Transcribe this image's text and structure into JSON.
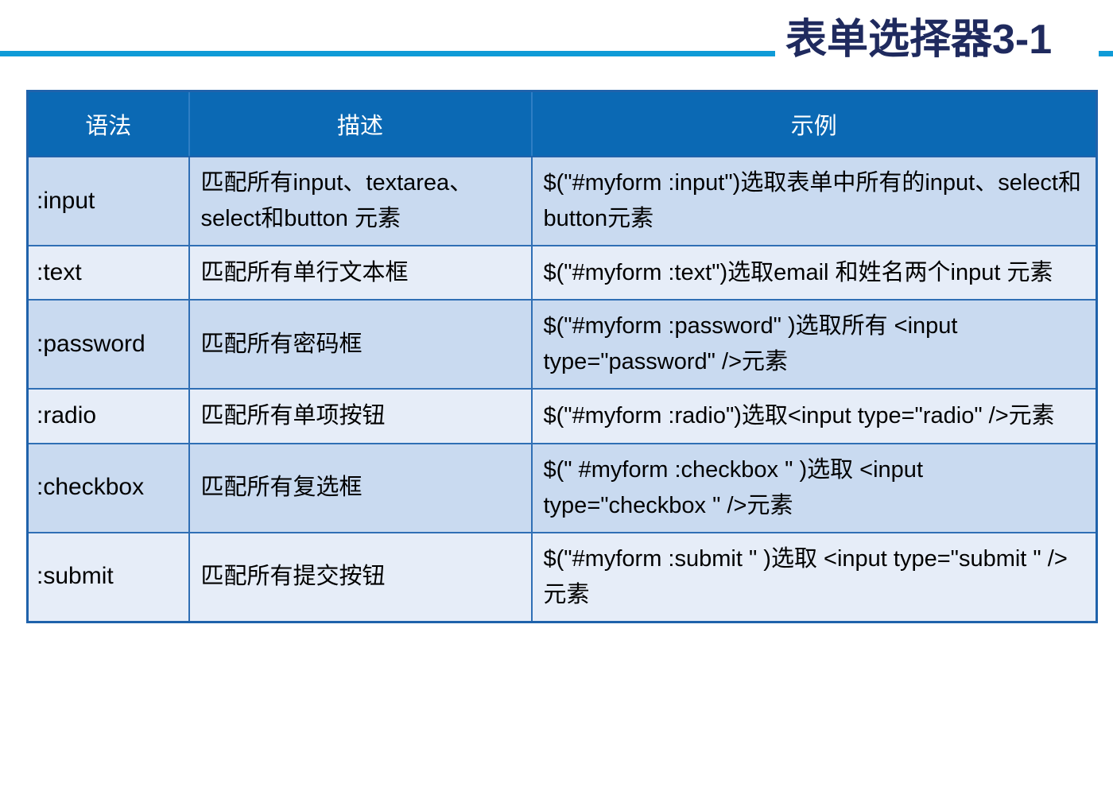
{
  "header": {
    "title": "表单选择器3-1",
    "rule_color": "#0f9bd7",
    "title_color": "#1f2a5e"
  },
  "table": {
    "header_bg": "#0b69b4",
    "border_color": "#1f62ab",
    "row_odd_bg": "#c9daf0",
    "row_even_bg": "#e6edf8",
    "columns": [
      "语法",
      "描述",
      "示例"
    ],
    "rows": [
      {
        "syntax": ":input",
        "description": "匹配所有input、textarea、select和button 元素",
        "example": "$(\"#myform  :input\")选取表单中所有的input、select和button元素"
      },
      {
        "syntax": ":text",
        "description": "匹配所有单行文本框",
        "example": "$(\"#myform  :text\")选取email 和姓名两个input 元素"
      },
      {
        "syntax": ":password",
        "description": "匹配所有密码框",
        "example": "$(\"#myform  :password\" )选取所有 <input type=\"password\" />元素"
      },
      {
        "syntax": ":radio",
        "description": "匹配所有单项按钮",
        "example": "$(\"#myform  :radio\")选取<input type=\"radio\" />元素"
      },
      {
        "syntax": ":checkbox",
        "description": "匹配所有复选框",
        "example": "$(\" #myform  :checkbox \" )选取 <input type=\"checkbox \" />元素"
      },
      {
        "syntax": ":submit",
        "description": "匹配所有提交按钮",
        "example": "$(\"#myform  :submit \" )选取 <input type=\"submit \" />元素"
      }
    ]
  }
}
